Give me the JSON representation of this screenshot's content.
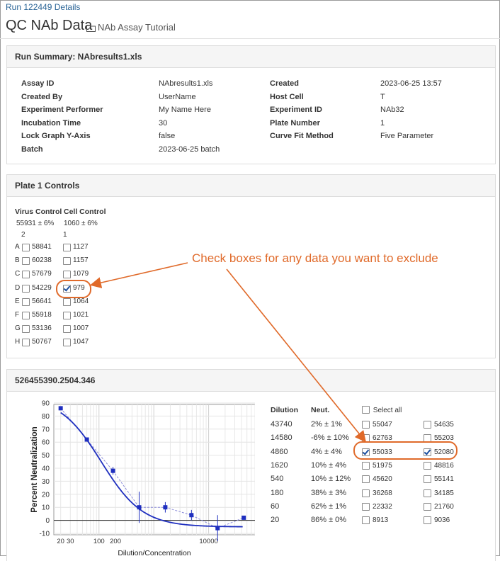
{
  "breadcrumb": "Run 122449 Details",
  "page_title": "QC NAb Data",
  "folder_link": "NAb Assay Tutorial",
  "run_summary": {
    "title": "Run Summary: NAbresults1.xls",
    "left": [
      {
        "label": "Assay ID",
        "value": "NAbresults1.xls"
      },
      {
        "label": "Created By",
        "value": "UserName"
      },
      {
        "label": "Experiment Performer",
        "value": "My Name Here"
      },
      {
        "label": "Incubation Time",
        "value": "30"
      },
      {
        "label": "Lock Graph Y-Axis",
        "value": "false"
      },
      {
        "label": "Batch",
        "value": "2023-06-25 batch"
      }
    ],
    "right": [
      {
        "label": "Created",
        "value": "2023-06-25 13:57"
      },
      {
        "label": "Host Cell",
        "value": "T"
      },
      {
        "label": "Experiment ID",
        "value": "NAb32"
      },
      {
        "label": "Plate Number",
        "value": "1"
      },
      {
        "label": "Curve Fit Method",
        "value": "Five Parameter"
      }
    ]
  },
  "plate_controls": {
    "title": "Plate 1 Controls",
    "virus_header": "Virus Control",
    "cell_header": "Cell Control",
    "virus_stat": "55931 ± 6%",
    "cell_stat": "1060 ± 6%",
    "virus_count": "2",
    "cell_count": "1",
    "rows": [
      {
        "letter": "A",
        "virus": "58841",
        "cell": "1127",
        "cell_checked": false
      },
      {
        "letter": "B",
        "virus": "60238",
        "cell": "1157",
        "cell_checked": false
      },
      {
        "letter": "C",
        "virus": "57679",
        "cell": "1079",
        "cell_checked": false
      },
      {
        "letter": "D",
        "virus": "54229",
        "cell": "979",
        "cell_checked": true
      },
      {
        "letter": "E",
        "virus": "56641",
        "cell": "1064",
        "cell_checked": false
      },
      {
        "letter": "F",
        "virus": "55918",
        "cell": "1021",
        "cell_checked": false
      },
      {
        "letter": "G",
        "virus": "53136",
        "cell": "1007",
        "cell_checked": false
      },
      {
        "letter": "H",
        "virus": "50767",
        "cell": "1047",
        "cell_checked": false
      }
    ]
  },
  "annotation": "Check boxes for any data you want to exclude",
  "sample": {
    "title": "526455390.2504.346",
    "dilution_header": "Dilution",
    "neut_header": "Neut.",
    "select_all": "Select all",
    "rows": [
      {
        "dilution": "43740",
        "neut": "2% ± 1%",
        "w1": "55047",
        "w1_checked": false,
        "w2": "54635",
        "w2_checked": false
      },
      {
        "dilution": "14580",
        "neut": "-6% ± 10%",
        "w1": "62763",
        "w1_checked": false,
        "w2": "55203",
        "w2_checked": false
      },
      {
        "dilution": "4860",
        "neut": "4% ± 4%",
        "w1": "55033",
        "w1_checked": true,
        "w2": "52080",
        "w2_checked": true
      },
      {
        "dilution": "1620",
        "neut": "10% ± 4%",
        "w1": "51975",
        "w1_checked": false,
        "w2": "48816",
        "w2_checked": false
      },
      {
        "dilution": "540",
        "neut": "10% ± 12%",
        "w1": "45620",
        "w1_checked": false,
        "w2": "55141",
        "w2_checked": false
      },
      {
        "dilution": "180",
        "neut": "38% ± 3%",
        "w1": "36268",
        "w1_checked": false,
        "w2": "34185",
        "w2_checked": false
      },
      {
        "dilution": "60",
        "neut": "62% ± 1%",
        "w1": "22332",
        "w1_checked": false,
        "w2": "21760",
        "w2_checked": false
      },
      {
        "dilution": "20",
        "neut": "86% ± 0%",
        "w1": "8913",
        "w1_checked": false,
        "w2": "9036",
        "w2_checked": false
      }
    ]
  },
  "chart_data": {
    "type": "scatter",
    "xlabel": "Dilution/Concentration",
    "ylabel": "Percent Neutralization",
    "x_scale": "log",
    "x_ticks": [
      "20",
      "30",
      "100",
      "200",
      "10000"
    ],
    "y_ticks": [
      90,
      80,
      70,
      60,
      50,
      40,
      30,
      20,
      10,
      0,
      -10
    ],
    "ylim": [
      -10,
      90
    ],
    "points": [
      {
        "x": 20,
        "y": 86,
        "err": 0
      },
      {
        "x": 60,
        "y": 62,
        "err": 1
      },
      {
        "x": 180,
        "y": 38,
        "err": 3
      },
      {
        "x": 540,
        "y": 10,
        "err": 12
      },
      {
        "x": 1620,
        "y": 10,
        "err": 4
      },
      {
        "x": 4860,
        "y": 4,
        "err": 4
      },
      {
        "x": 14580,
        "y": -6,
        "err": 10
      },
      {
        "x": 43740,
        "y": 2,
        "err": 1
      }
    ],
    "curve_color": "#1f2fbf",
    "point_color": "#1f2fbf"
  }
}
